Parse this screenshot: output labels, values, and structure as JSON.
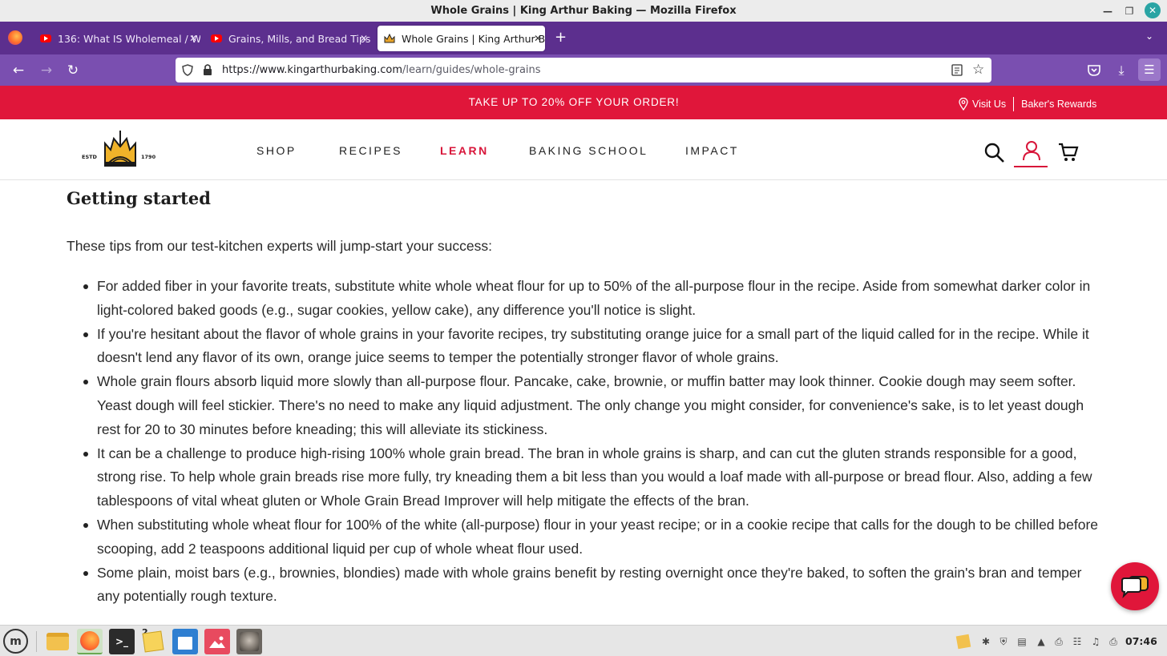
{
  "window": {
    "title": "Whole Grains | King Arthur Baking — Mozilla Firefox"
  },
  "tabs": [
    {
      "label": "136: What IS Wholemeal / W",
      "icon": "youtube-icon"
    },
    {
      "label": "Grains, Mills, and Bread Tips",
      "icon": "youtube-icon"
    },
    {
      "label": "Whole Grains | King Arthur B",
      "icon": "king-arthur-favicon",
      "active": true
    }
  ],
  "url": {
    "host": "https://www.kingarthurbaking.com",
    "path": "/learn/guides/whole-grains"
  },
  "promo": {
    "text": "TAKE UP TO 20% OFF YOUR ORDER!",
    "visit_us": "Visit Us",
    "rewards": "Baker's Rewards"
  },
  "logo": {
    "left": "ESTD",
    "right": "1790"
  },
  "nav": {
    "shop": "SHOP",
    "recipes": "RECIPES",
    "learn": "LEARN",
    "baking_school": "BAKING SCHOOL",
    "impact": "IMPACT"
  },
  "content": {
    "heading": "Getting started",
    "intro": "These tips from our test-kitchen experts will jump-start your success:",
    "tips": [
      "For added fiber in your favorite treats, substitute white whole wheat flour for up to 50% of the all-purpose flour in the recipe. Aside from somewhat darker color in light-colored baked goods (e.g., sugar cookies, yellow cake), any difference you'll notice is slight.",
      "If you're hesitant about the flavor of whole grains in your favorite recipes, try substituting orange juice for a small part of the liquid called for in the recipe. While it doesn't lend any flavor of its own, orange juice seems to temper the potentially stronger flavor of whole grains.",
      "Whole grain flours absorb liquid more slowly than all-purpose flour. Pancake, cake, brownie, or muffin batter may look thinner. Cookie dough may seem softer. Yeast dough will feel stickier. There's no need to make any liquid adjustment. The only change you might consider, for convenience's sake, is to let yeast dough rest for 20 to 30 minutes before kneading; this will alleviate its stickiness.",
      "It can be a challenge to produce high-rising 100% whole grain bread. The bran in whole grains is sharp, and can cut the gluten strands responsible for a good, strong rise. To help whole grain breads rise more fully, try kneading them a bit less than you would a loaf made with all-purpose or bread flour. Also, adding a few tablespoons of vital wheat gluten or Whole Grain Bread Improver will help mitigate the effects of the bran.",
      "When substituting whole wheat flour for 100% of the white (all-purpose) flour in your yeast recipe; or in a cookie recipe that calls for the dough to be chilled before scooping, add 2 teaspoons additional liquid per cup of whole wheat flour used.",
      "Some plain, moist bars (e.g., brownies, blondies) made with whole grains benefit by resting overnight once they're baked, to soften the grain's bran and temper any potentially rough texture."
    ]
  },
  "taskbar": {
    "clock": "07:46",
    "workspace_badge": "2"
  },
  "colors": {
    "brand_red": "#e0163a",
    "firefox_purple": "#5c2f8e",
    "toolbar_purple": "#7a4fb0"
  }
}
